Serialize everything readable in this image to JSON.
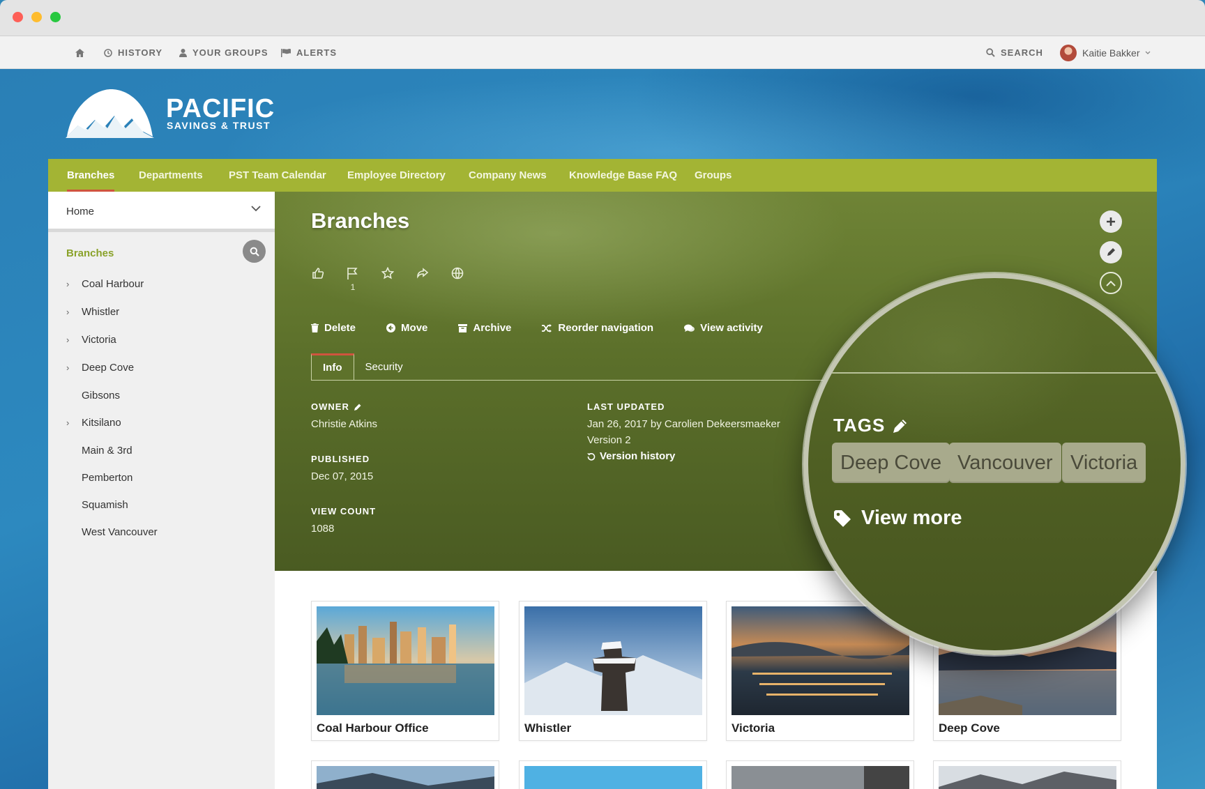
{
  "topbar": {
    "history": "HISTORY",
    "your_groups": "YOUR GROUPS",
    "alerts": "ALERTS",
    "search": "SEARCH",
    "user_name": "Kaitie Bakker"
  },
  "brand": {
    "word": "PACIFIC",
    "sub": "SAVINGS & TRUST"
  },
  "nav": {
    "items": [
      "Branches",
      "Departments",
      "PST Team Calendar",
      "Employee Directory",
      "Company News",
      "Knowledge Base FAQ",
      "Groups"
    ]
  },
  "sidebar": {
    "home": "Home",
    "title": "Branches",
    "items": [
      {
        "label": "Coal Harbour",
        "expandable": true
      },
      {
        "label": "Whistler",
        "expandable": true
      },
      {
        "label": "Victoria",
        "expandable": true
      },
      {
        "label": "Deep Cove",
        "expandable": true
      },
      {
        "label": "Gibsons",
        "expandable": false
      },
      {
        "label": "Kitsilano",
        "expandable": true
      },
      {
        "label": "Main & 3rd",
        "expandable": false
      },
      {
        "label": "Pemberton",
        "expandable": false
      },
      {
        "label": "Squamish",
        "expandable": false
      },
      {
        "label": "West Vancouver",
        "expandable": false
      }
    ]
  },
  "page": {
    "title": "Branches",
    "flag_count": "1",
    "actions": {
      "delete": "Delete",
      "move": "Move",
      "archive": "Archive",
      "reorder": "Reorder navigation",
      "activity": "View activity"
    },
    "tabs": {
      "info": "Info",
      "security": "Security"
    },
    "meta": {
      "owner_label": "OWNER",
      "owner": "Christie Atkins",
      "published_label": "PUBLISHED",
      "published": "Dec 07, 2015",
      "view_count_label": "VIEW COUNT",
      "view_count": "1088",
      "last_updated_label": "LAST UPDATED",
      "last_updated": "Jan 26, 2017 by Carolien Dekeersmaeker",
      "version": "Version 2",
      "version_history": "Version history"
    },
    "tags": {
      "label": "TAGS",
      "items": [
        "Deep Cove",
        "Vancouver",
        "Victoria"
      ],
      "view_more": "View more"
    }
  },
  "cards": [
    {
      "title": "Coal Harbour Office"
    },
    {
      "title": "Whistler"
    },
    {
      "title": "Victoria"
    },
    {
      "title": "Deep Cove"
    }
  ],
  "colors": {
    "nav_green": "#a3b434",
    "accent_red": "#d0543e",
    "sidebar_title": "#8aa22a",
    "band_blue": "#2d89bf"
  }
}
